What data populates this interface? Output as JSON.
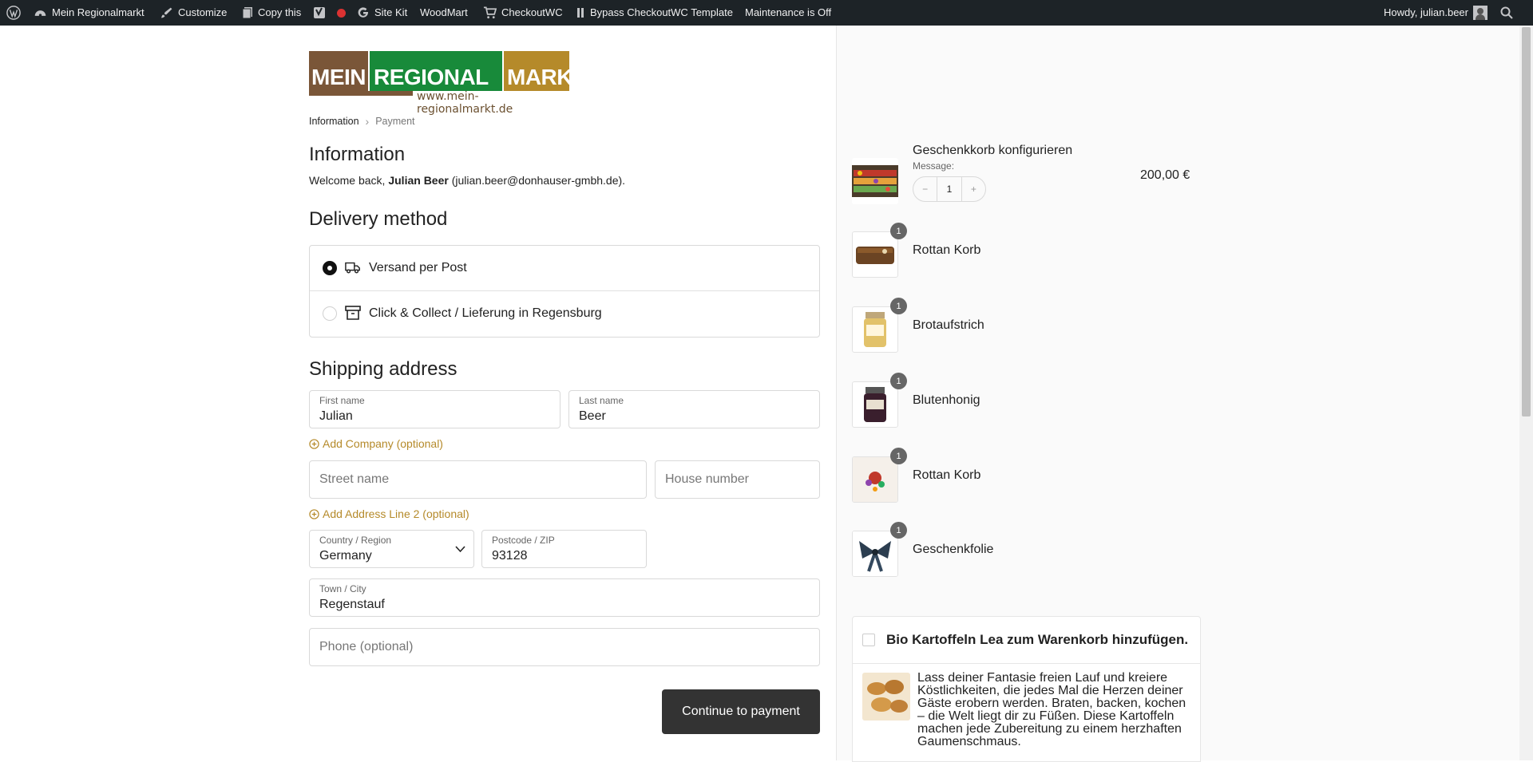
{
  "admin_bar": {
    "site_name": "Mein Regionalmarkt",
    "customize": "Customize",
    "copy_this": "Copy this",
    "site_kit": "Site Kit",
    "woodmart": "WoodMart",
    "checkoutwc": "CheckoutWC",
    "bypass": "Bypass CheckoutWC Template",
    "maintenance": "Maintenance is Off",
    "howdy": "Howdy, julian.beer"
  },
  "logo": {
    "part1": "MEIN",
    "part2": "REGIONAL",
    "part3": "MARKT",
    "url": "www.mein-regionalmarkt.de"
  },
  "breadcrumb": {
    "step1": "Information",
    "separator": "›",
    "step2": "Payment"
  },
  "information": {
    "heading": "Information",
    "welcome_prefix": "Welcome back,",
    "welcome_name": "Julian Beer",
    "welcome_email": "(julian.beer@donhauser-gmbh.de)."
  },
  "delivery": {
    "heading": "Delivery method",
    "options": [
      {
        "label": "Versand per Post",
        "selected": true,
        "icon": "truck-icon"
      },
      {
        "label": "Click & Collect / Lieferung in Regensburg",
        "selected": false,
        "icon": "archive-box-icon"
      }
    ]
  },
  "shipping": {
    "heading": "Shipping address",
    "first_name": {
      "label": "First name",
      "value": "Julian"
    },
    "last_name": {
      "label": "Last name",
      "value": "Beer"
    },
    "add_company": "Add Company (optional)",
    "street_placeholder": "Street name",
    "house_placeholder": "House number",
    "add_line2": "Add Address Line 2 (optional)",
    "country": {
      "label": "Country / Region",
      "value": "Germany"
    },
    "postcode": {
      "label": "Postcode / ZIP",
      "value": "93128"
    },
    "town": {
      "label": "Town / City",
      "value": "Regenstauf"
    },
    "phone_placeholder": "Phone (optional)"
  },
  "continue_button": "Continue to payment",
  "cart": {
    "main_item": {
      "name": "Geschenkkorb konfigurieren",
      "message_label": "Message:",
      "quantity": "1",
      "minus": "−",
      "plus": "+",
      "price": "200,00 €"
    },
    "sub_items": [
      {
        "name": "Rottan Korb",
        "qty": "1"
      },
      {
        "name": "Brotaufstrich",
        "qty": "1"
      },
      {
        "name": "Blutenhonig",
        "qty": "1"
      },
      {
        "name": "Rottan Korb",
        "qty": "1"
      },
      {
        "name": "Geschenkfolie",
        "qty": "1"
      }
    ]
  },
  "upsell": {
    "title": "Bio Kartoffeln Lea zum Warenkorb hinzufügen.",
    "description": "Lass deiner Fantasie freien Lauf und kreiere Köstlichkeiten, die jedes Mal die Herzen deiner Gäste erobern werden. Braten, backen, kochen – die Welt liegt dir zu Füßen. Diese Kartoffeln machen jede Zubereitung zu einem herzhaften Gaumenschmaus."
  },
  "colors": {
    "admin_bar": "#1d2327",
    "accent": "#b58a2a",
    "button": "#333333",
    "logo_brown": "#7a5638",
    "logo_green": "#188a3a",
    "logo_gold": "#b58a2a"
  }
}
